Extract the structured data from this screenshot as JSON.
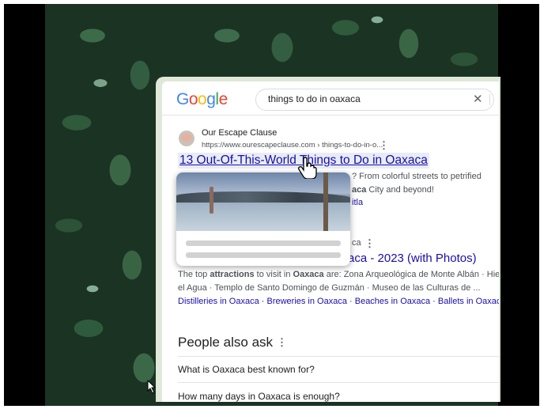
{
  "search": {
    "query": "things to do in oaxaca"
  },
  "result1": {
    "site_name": "Our Escape Clause",
    "url": "https://www.ourescapeclause.com › things-to-do-in-o...",
    "title": "13 Out-Of-This-World Things to Do in Oaxaca",
    "snippet_line1": "? From colorful streets to petrified",
    "snippet_line2_bold": "aca",
    "snippet_line2_rest": " City and beyond!",
    "sitelink": "itla"
  },
  "result2": {
    "site_fragment": "ca",
    "title": "aca - 2023 (with Photos)",
    "snippet_line1_a": "The top ",
    "snippet_line1_bold1": "attractions",
    "snippet_line1_b": " to visit in ",
    "snippet_line1_bold2": "Oaxaca",
    "snippet_line1_c": " are: Zona Arqueológica de Monte Albán · Hierve",
    "snippet_line2": "el Agua · Templo de Santo Domingo de Guzmán · Museo de las Culturas de ...",
    "sitelinks": "Distilleries in Oaxaca · Breweries in Oaxaca · Beaches in Oaxaca · Ballets in Oaxaca"
  },
  "people_also_ask": {
    "title": "People also ask",
    "questions": [
      "What is Oaxaca best known for?",
      "How many days in Oaxaca is enough?"
    ]
  },
  "icons": [
    "google-logo",
    "clear-icon",
    "more-vert-icon",
    "hand-pointer-cursor",
    "arrow-cursor"
  ],
  "colors": {
    "link": "#1a0dab",
    "snippet": "#4d5156",
    "google_blue": "#4285f4",
    "google_red": "#ea4335",
    "google_yellow": "#fbbc05",
    "google_green": "#34a853"
  }
}
